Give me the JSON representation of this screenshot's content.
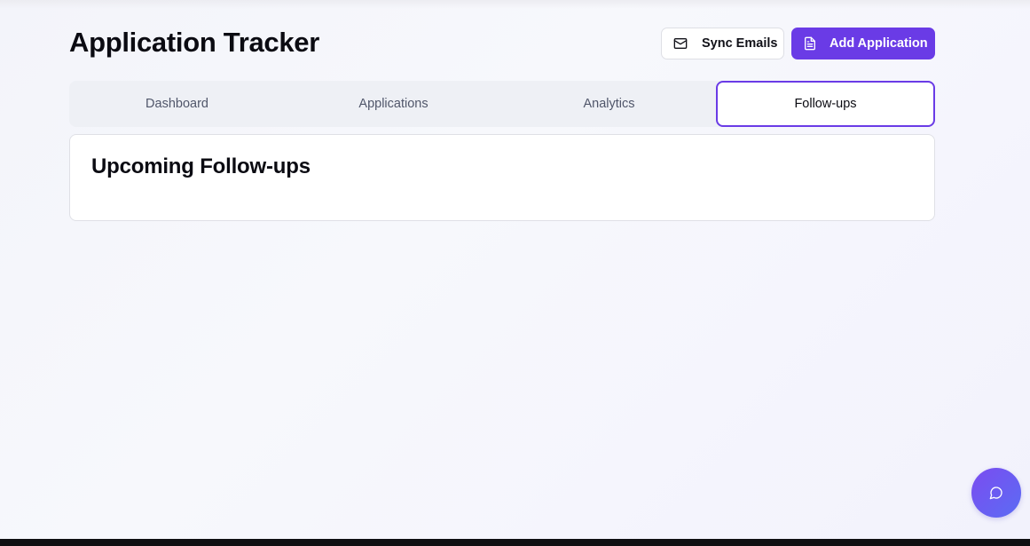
{
  "header": {
    "title": "Application Tracker",
    "sync_label": "Sync Emails",
    "sync_icon": "mail-icon",
    "add_label": "Add Application",
    "add_icon": "document-icon",
    "accent_color": "#6a3be6"
  },
  "tabs": [
    {
      "label": "Dashboard",
      "active": false
    },
    {
      "label": "Applications",
      "active": false
    },
    {
      "label": "Analytics",
      "active": false
    },
    {
      "label": "Follow-ups",
      "active": true
    }
  ],
  "card": {
    "title": "Upcoming Follow-ups"
  },
  "fab": {
    "icon": "chat-bubble-icon"
  }
}
